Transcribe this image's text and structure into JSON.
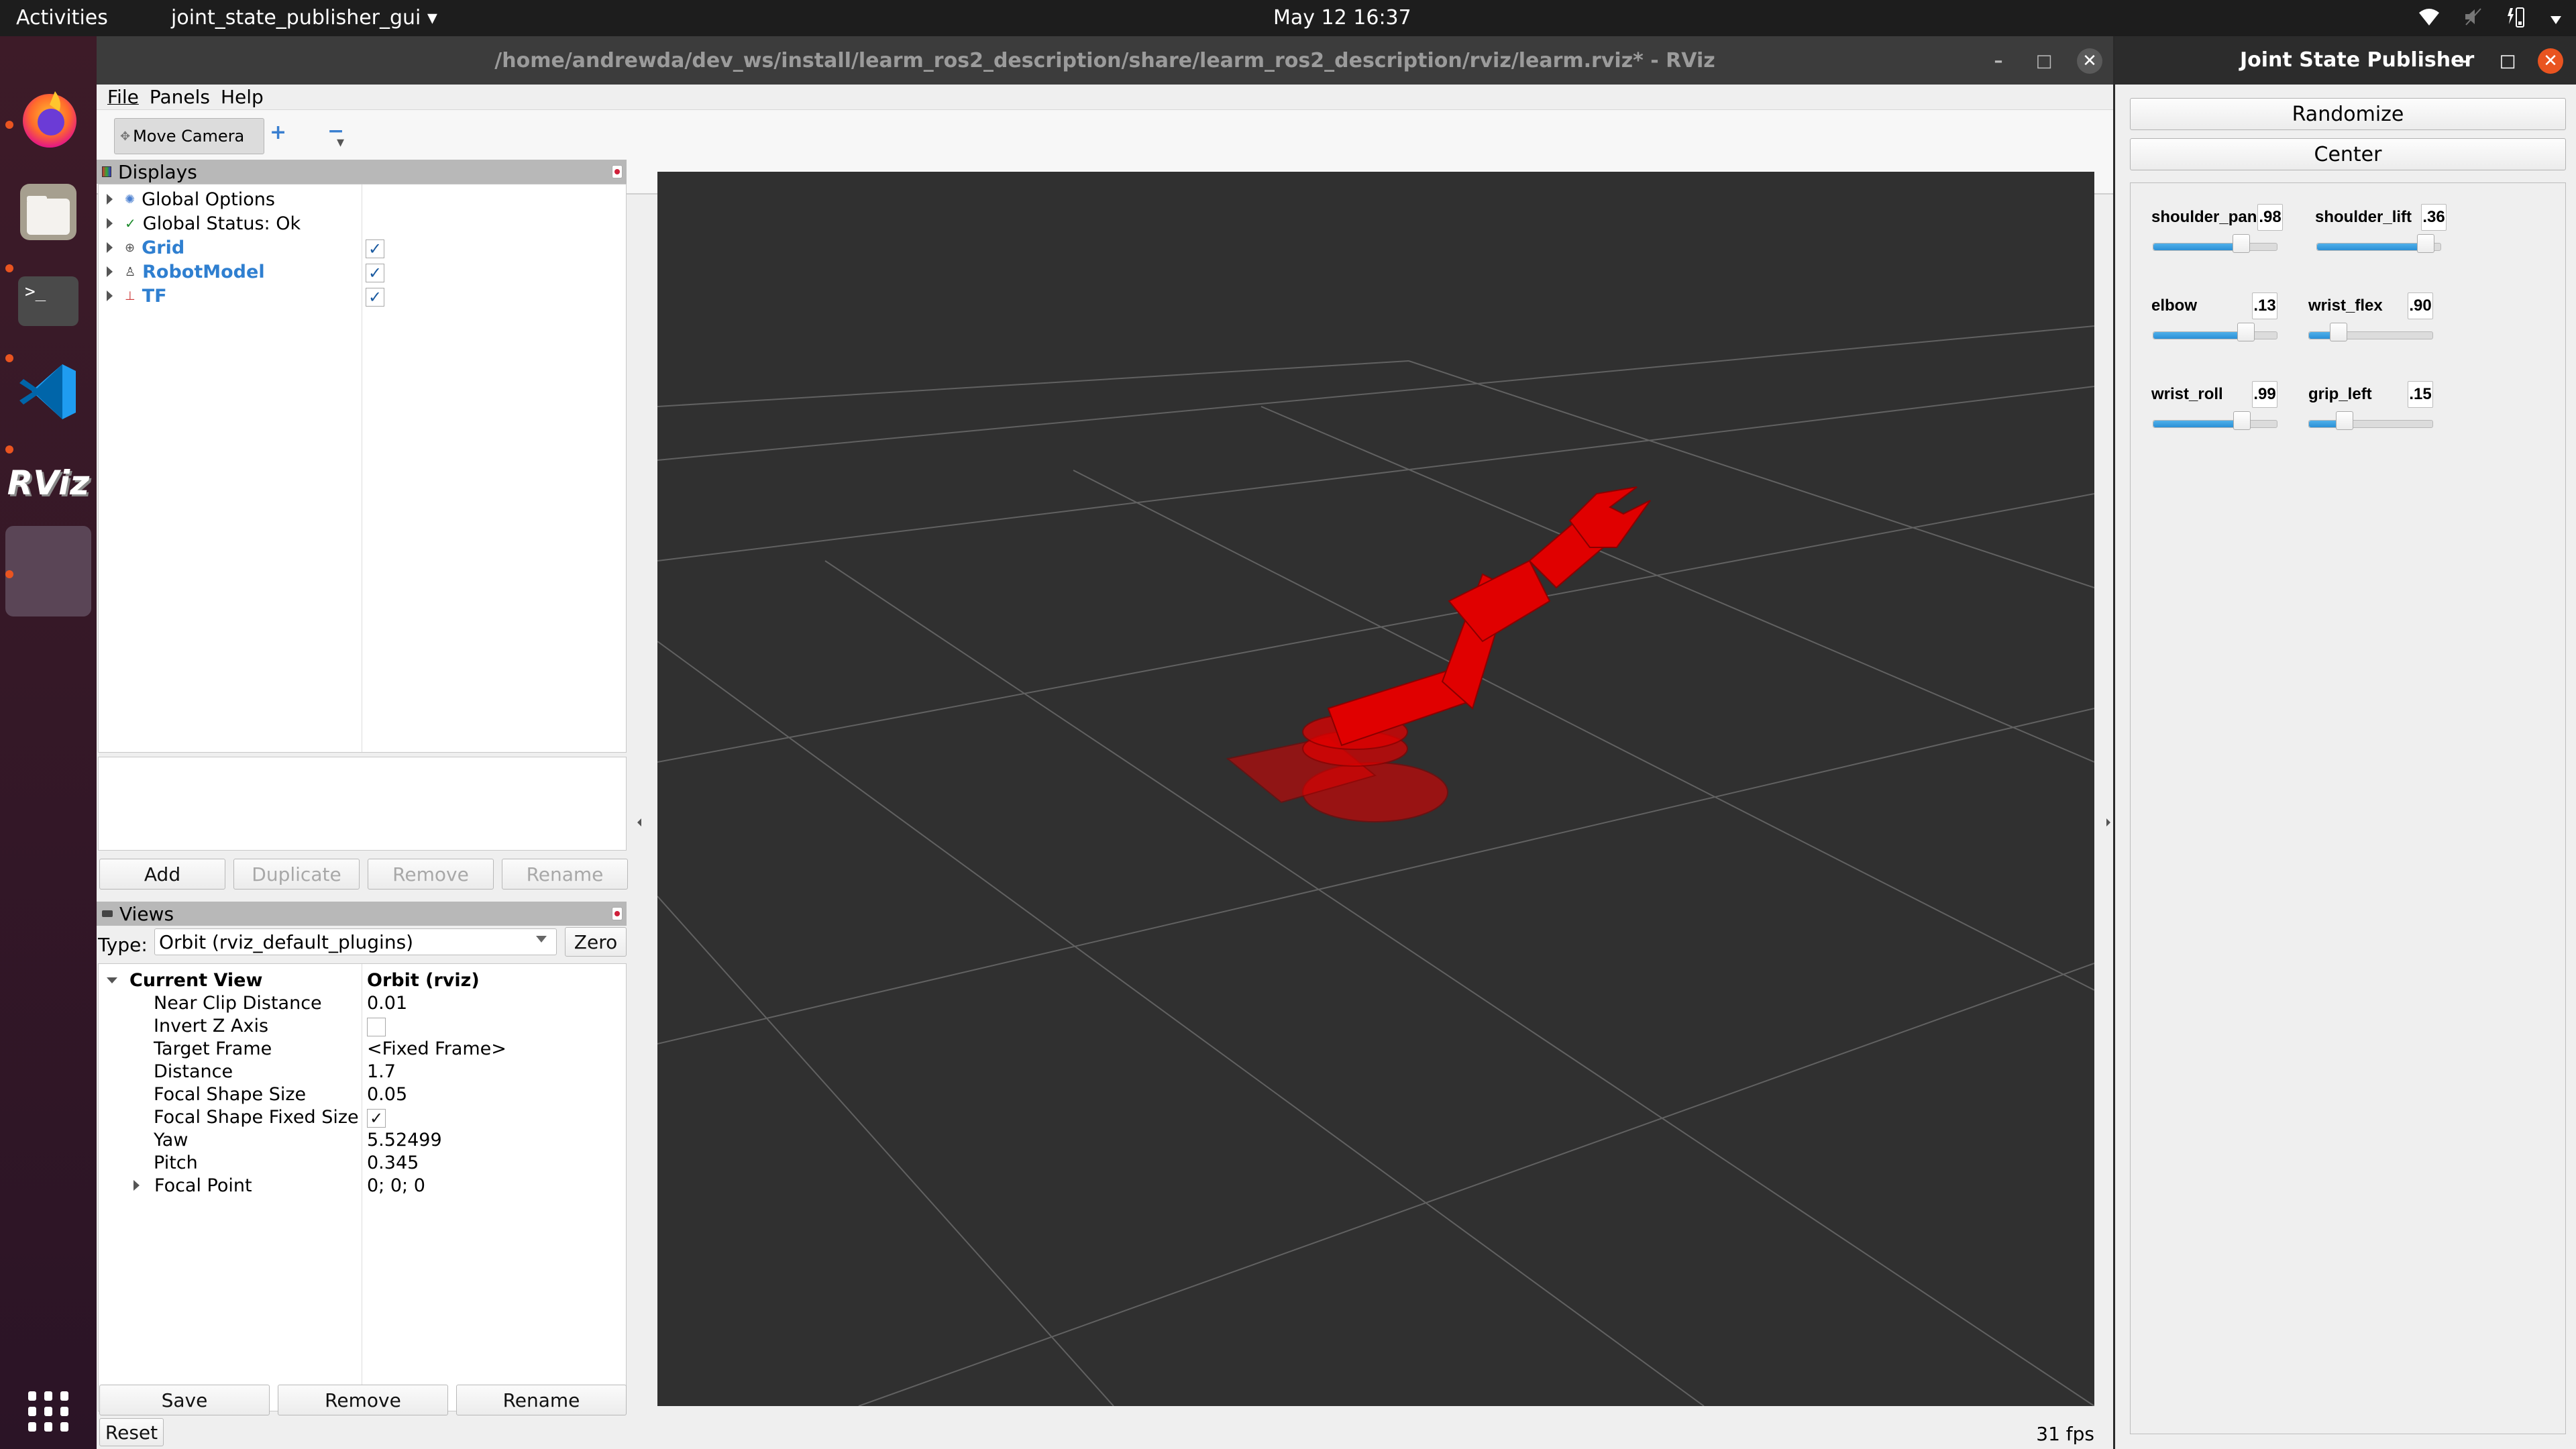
{
  "topbar": {
    "activities": "Activities",
    "app_menu": "joint_state_publisher_gui ▾",
    "clock": "May 12  16:37",
    "tray_icons": [
      "wifi-icon",
      "volume-muted-icon",
      "battery-charging-icon",
      "system-menu-arrow-icon"
    ]
  },
  "dock": {
    "apps": [
      "Firefox",
      "Files",
      "Terminal",
      "Visual Studio Code",
      "RViz",
      "Joint State Publisher (active)"
    ],
    "terminal_glyph": ">_",
    "rviz_glyph": "RViz",
    "app_grid_glyph": "⋮⋮⋮"
  },
  "rviz": {
    "title": "/home/andrewda/dev_ws/install/learm_ros2_description/share/learm_ros2_description/rviz/learm.rviz* - RViz",
    "window_controls": {
      "minimize": "–",
      "maximize": "□",
      "close": "✕"
    },
    "menu": [
      "File",
      "Panels",
      "Help"
    ],
    "toolbar": {
      "move_camera": "Move Camera",
      "add_tool": "+",
      "remove_tool": "−",
      "dropdown": "▾"
    },
    "displays": {
      "title": "Displays",
      "items": [
        {
          "label": "Global Options",
          "icon": "gear-icon",
          "checkable": false
        },
        {
          "label": "Global Status: Ok",
          "icon": "check-icon",
          "checkable": false
        },
        {
          "label": "Grid",
          "icon": "grid-icon",
          "checkable": true,
          "checked": true
        },
        {
          "label": "RobotModel",
          "icon": "robot-icon",
          "checkable": true,
          "checked": true
        },
        {
          "label": "TF",
          "icon": "axes-icon",
          "checkable": true,
          "checked": true
        }
      ],
      "buttons": {
        "add": "Add",
        "duplicate": "Duplicate",
        "remove": "Remove",
        "rename": "Rename"
      }
    },
    "views": {
      "title": "Views",
      "type_label": "Type:",
      "type_value": "Orbit (rviz_default_plugins)",
      "zero": "Zero",
      "current_view": {
        "label": "Current View",
        "value": "Orbit (rviz)"
      },
      "properties": [
        {
          "name": "Near Clip Distance",
          "value": "0.01"
        },
        {
          "name": "Invert Z Axis",
          "value": "",
          "checkbox": true,
          "checked": false
        },
        {
          "name": "Target Frame",
          "value": "<Fixed Frame>"
        },
        {
          "name": "Distance",
          "value": "1.7"
        },
        {
          "name": "Focal Shape Size",
          "value": "0.05"
        },
        {
          "name": "Focal Shape Fixed Size",
          "value": "✓",
          "checkbox": true,
          "checked": true
        },
        {
          "name": "Yaw",
          "value": "5.52499"
        },
        {
          "name": "Pitch",
          "value": "0.345"
        },
        {
          "name": "Focal Point",
          "value": "0; 0; 0",
          "expandable": true
        }
      ],
      "buttons": {
        "save": "Save",
        "remove": "Remove",
        "rename": "Rename"
      }
    },
    "reset": "Reset",
    "fps": "31 fps",
    "viewport": {
      "background": "#303030",
      "grid_color": "#8a8a8a",
      "robot_color": "#e00000"
    }
  },
  "jsp": {
    "title": "Joint State Publisher",
    "window_controls": {
      "minimize": "–",
      "maximize": "□",
      "close": "✕"
    },
    "randomize": "Randomize",
    "center": "Center",
    "joints": [
      {
        "name": "shoulder_pan",
        "value": ".98",
        "fraction": 0.71
      },
      {
        "name": "shoulder_lift",
        "value": ".36",
        "fraction": 0.88
      },
      {
        "name": "elbow",
        "value": ".13",
        "fraction": 0.75
      },
      {
        "name": "wrist_flex",
        "value": ".90",
        "fraction": 0.24
      },
      {
        "name": "wrist_roll",
        "value": ".99",
        "fraction": 0.72
      },
      {
        "name": "grip_left",
        "value": ".15",
        "fraction": 0.29
      }
    ],
    "accent": "#2b8fd6"
  }
}
